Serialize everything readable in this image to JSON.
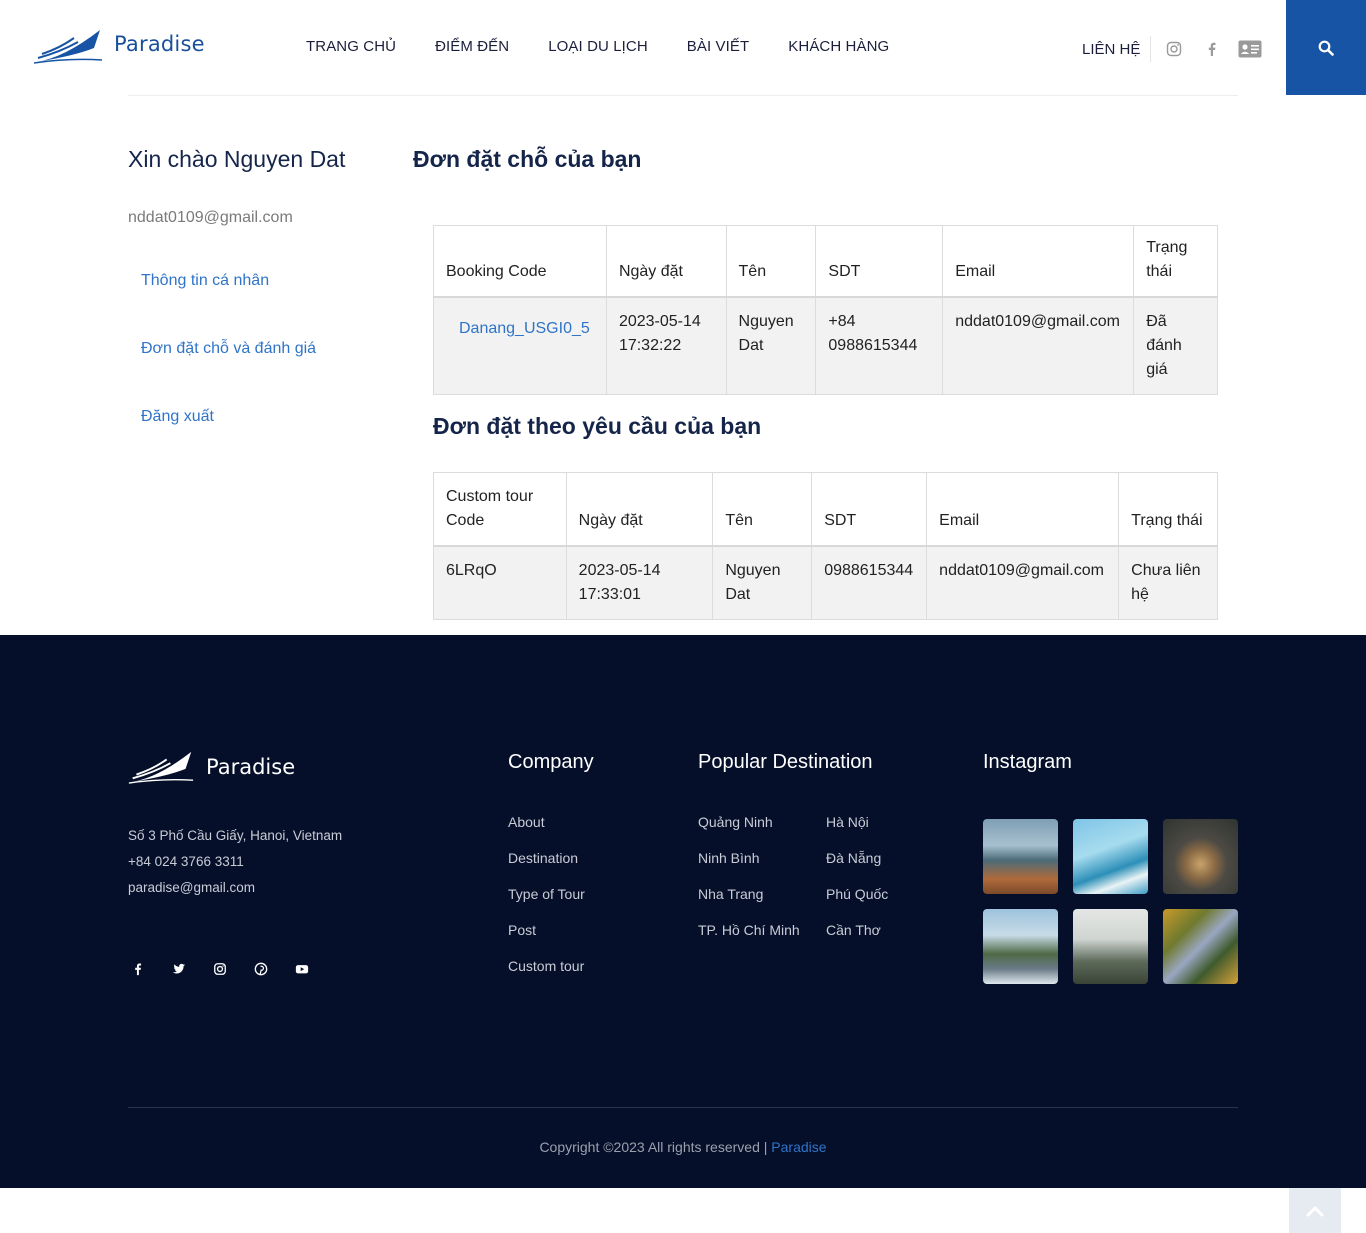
{
  "header": {
    "brand": "Paradise",
    "nav": [
      "TRANG CHỦ",
      "ĐIỂM ĐẾN",
      "LOẠI DU LỊCH",
      "BÀI VIẾT",
      "KHÁCH HÀNG"
    ],
    "contact": "LIÊN HỆ",
    "icons": [
      "instagram-icon",
      "facebook-icon",
      "contact-card-icon",
      "search-icon"
    ],
    "accent_color": "#1754a5"
  },
  "sidebar": {
    "greeting": "Xin chào Nguyen Dat",
    "email": "nddat0109@gmail.com",
    "links": [
      "Thông tin cá nhân",
      "Đơn đặt chỗ và đánh giá",
      "Đăng xuất"
    ]
  },
  "bookings": {
    "title": "Đơn đặt chỗ của bạn",
    "headers": [
      "Booking Code",
      "Ngày đặt",
      "Tên",
      "SDT",
      "Email",
      "Trạng thái"
    ],
    "rows": [
      {
        "code": "Danang_USGI0_5",
        "date": "2023-05-14 17:32:22",
        "name": "Nguyen Dat",
        "phone": "+84 0988615344",
        "email": "nddat0109@gmail.com",
        "status": "Đã đánh giá"
      }
    ]
  },
  "custom_tours": {
    "title": "Đơn đặt theo yêu cầu của bạn",
    "headers": [
      "Custom tour Code",
      "Ngày đặt",
      "Tên",
      "SDT",
      "Email",
      "Trạng thái"
    ],
    "rows": [
      {
        "code": "6LRqO",
        "date": "2023-05-14 17:33:01",
        "name": "Nguyen Dat",
        "phone": "0988615344",
        "email": "nddat0109@gmail.com",
        "status": "Chưa liên hệ"
      }
    ]
  },
  "footer": {
    "brand": "Paradise",
    "address": "Số 3 Phố Cầu Giấy, Hanoi, Vietnam",
    "phone": "+84 024 3766 3311",
    "email": "paradise@gmail.com",
    "social_icons": [
      "facebook-icon",
      "twitter-icon",
      "instagram-icon",
      "pinterest-icon",
      "youtube-icon"
    ],
    "company_title": "Company",
    "company_links": [
      "About",
      "Destination",
      "Type of Tour",
      "Post",
      "Custom tour"
    ],
    "destination_title": "Popular Destination",
    "destinations_col1": [
      "Quảng Ninh",
      "Ninh Bình",
      "Nha Trang",
      "TP. Hồ Chí Minh"
    ],
    "destinations_col2": [
      "Hà Nội",
      "Đà Nẵng",
      "Phú Quốc",
      "Cần Thơ"
    ],
    "instagram_title": "Instagram",
    "copyright": "Copyright ©2023 All rights reserved |",
    "copyright_brand": "Paradise",
    "background_color": "#050f2a"
  }
}
